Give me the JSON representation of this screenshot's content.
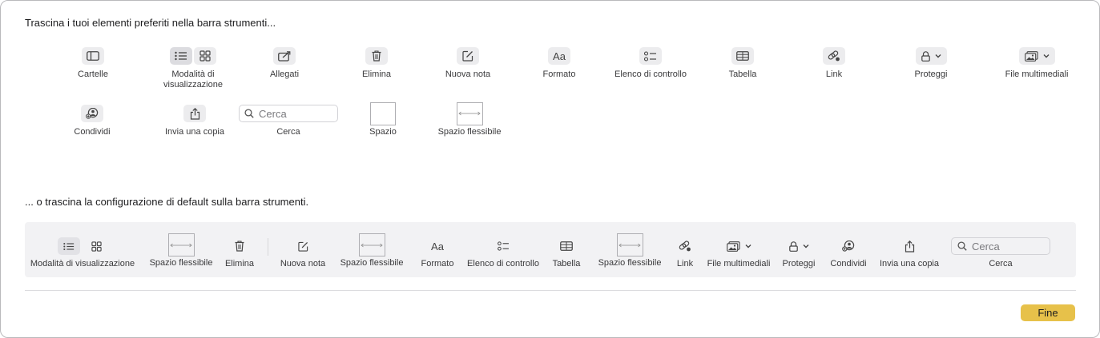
{
  "instructions": {
    "top": "Trascina i tuoi elementi preferiti nella barra strumenti...",
    "bottom": "... o trascina la configurazione di default sulla barra strumenti."
  },
  "palette": {
    "folders": "Cartelle",
    "view_mode": "Modalità di\nvisualizzazione",
    "attachments": "Allegati",
    "delete": "Elimina",
    "new_note": "Nuova nota",
    "format": "Formato",
    "format_glyph": "Aa",
    "checklist": "Elenco di controllo",
    "table": "Tabella",
    "link": "Link",
    "protect": "Proteggi",
    "media": "File multimediali",
    "share": "Condividi",
    "send_copy": "Invia una copia",
    "search": "Cerca",
    "search_placeholder": "Cerca",
    "space": "Spazio",
    "flex_space": "Spazio flessibile"
  },
  "default_bar": {
    "view_mode": "Modalità di visualizzazione",
    "flex_space_1": "Spazio flessibile",
    "delete": "Elimina",
    "new_note": "Nuova nota",
    "flex_space_2": "Spazio flessibile",
    "format": "Formato",
    "format_glyph": "Aa",
    "checklist": "Elenco di controllo",
    "table": "Tabella",
    "flex_space_3": "Spazio flessibile",
    "link": "Link",
    "media": "File multimediali",
    "protect": "Proteggi",
    "share": "Condividi",
    "send_copy": "Invia una copia",
    "search": "Cerca",
    "search_placeholder": "Cerca"
  },
  "done_button": "Fine",
  "colors": {
    "accent": "#e7c14a",
    "bar_bg": "#f2f2f4"
  }
}
